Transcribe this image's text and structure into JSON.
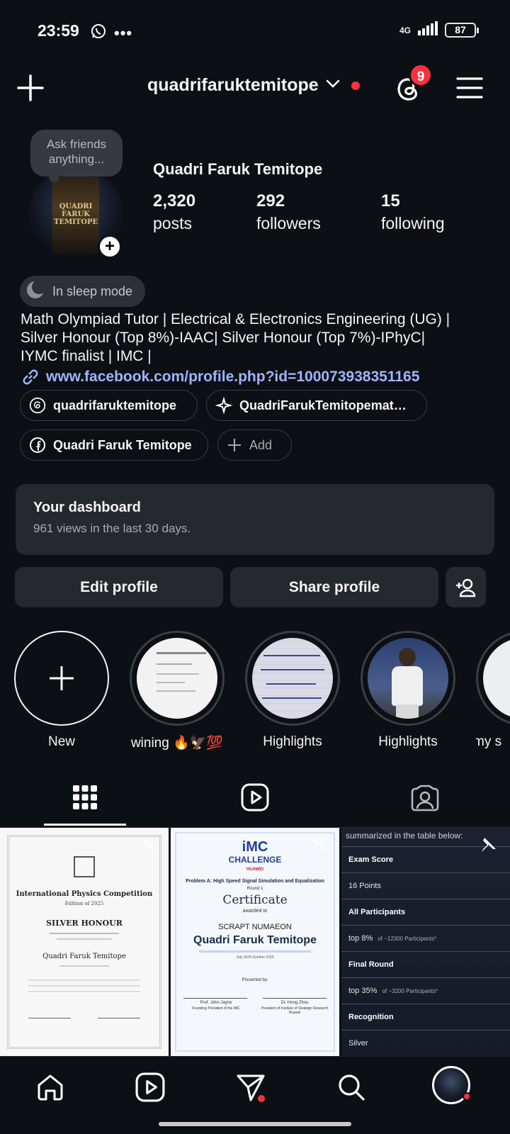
{
  "status_bar": {
    "time": "23:59",
    "network": "4G",
    "battery": "87",
    "icons": [
      "whatsapp-icon",
      "more-dots-icon",
      "signal-icon",
      "battery-icon"
    ]
  },
  "header": {
    "username": "quadrifaruktemitope",
    "notification_count": "9",
    "icons": [
      "plus-icon",
      "chevron-down-icon",
      "threads-icon",
      "menu-icon"
    ]
  },
  "profile": {
    "note": "Ask friends anything...",
    "display_name": "Quadri Faruk Temitope",
    "avatar_text": "QUADRI FARUK TEMITOPE",
    "stats": [
      {
        "num": "2,320",
        "label": "posts"
      },
      {
        "num": "292",
        "label": "followers"
      },
      {
        "num": "15",
        "label": "following"
      }
    ],
    "sleep_mode": "In sleep mode",
    "bio_line1": "Math Olympiad Tutor | Electrical & Electronics Engineering (UG) |",
    "bio_line2": "Silver Honour (Top 8%)-IAAC| Silver Honour (Top 7%)-IPhyC|",
    "bio_line3": "IYMC finalist | IMC |",
    "link": "www.facebook.com/profile.php?id=100073938351165"
  },
  "chips": {
    "threads": "quadrifaruktemitope",
    "ai": "QuadriFarukTemitopemat…",
    "facebook": "Quadri Faruk Temitope",
    "add": "Add"
  },
  "dashboard": {
    "title": "Your dashboard",
    "subtitle": "961 views in the last 30 days."
  },
  "buttons": {
    "edit": "Edit profile",
    "share": "Share profile"
  },
  "highlights": [
    {
      "label": "New"
    },
    {
      "label": "wining 🔥🦅💯"
    },
    {
      "label": "Highlights"
    },
    {
      "label": "Highlights"
    },
    {
      "label": "my s"
    }
  ],
  "grid": {
    "cert1": {
      "heading": "International Physics Competition",
      "edition": "Edition of 2025",
      "award": "SILVER HONOUR",
      "name": "Quadri Faruk Temitope"
    },
    "cert2": {
      "brand": "iMC",
      "brand2": "CHALLENGE",
      "sponsor": "HUAWEI",
      "problem": "Problem A: High Speed Signal Simulation and Equalization",
      "round": "Round 1",
      "title": "Certificate",
      "awarded": "awarded to",
      "team": "SCRAPT NUMAEON",
      "name": "Quadri Faruk Temitope",
      "dates": "July 2025-October 2025",
      "presented": "Presented by:",
      "sig1_name": "Prof. John Jayne",
      "sig1_role": "Founding President of the IMC",
      "sig2_name": "Dr. Hong Zhou",
      "sig2_role": "President of Institute of Strategic Research Huawei"
    },
    "cert3": {
      "caption": "summarized in the table below:",
      "rows": [
        {
          "k": "Exam Score",
          "v": ""
        },
        {
          "k": "",
          "v": "16 Points"
        },
        {
          "k": "All Participants",
          "v": ""
        },
        {
          "k": "",
          "v": "top 8%",
          "note": "of ~12300 Participants*"
        },
        {
          "k": "Final Round",
          "v": ""
        },
        {
          "k": "",
          "v": "top 35%",
          "note": "of ~3200 Participants*"
        },
        {
          "k": "Recognition",
          "v": ""
        },
        {
          "k": "",
          "v": "Silver"
        }
      ]
    }
  },
  "bottom_nav": [
    "home-icon",
    "reels-icon",
    "messages-icon",
    "search-icon",
    "profile-avatar"
  ]
}
